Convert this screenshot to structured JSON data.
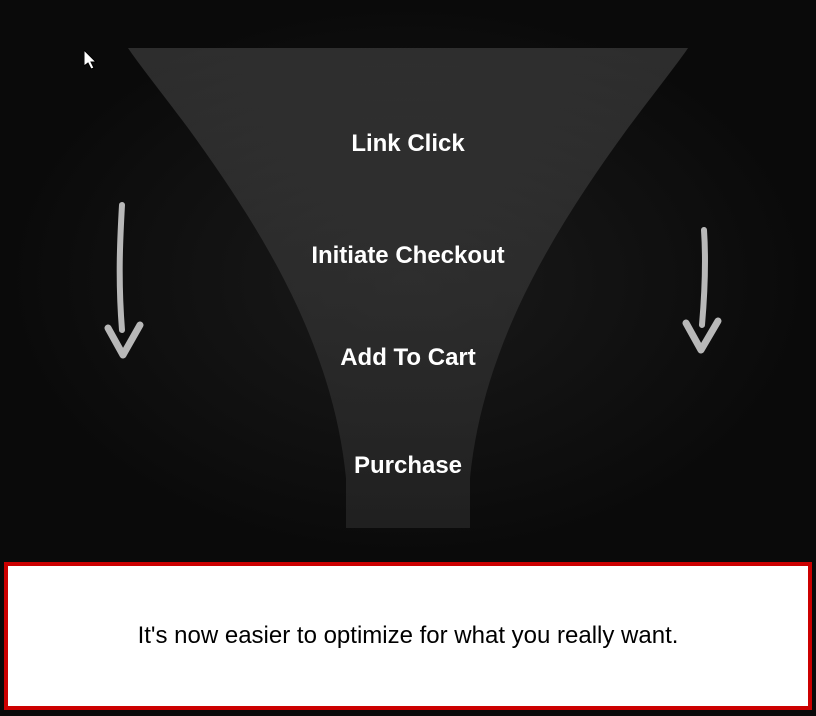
{
  "funnel": {
    "stages": [
      "Link Click",
      "Initiate Checkout",
      "Add To Cart",
      "Purchase"
    ]
  },
  "caption": "It's now easier to optimize for what you really want.",
  "colors": {
    "background": "#0a0a0a",
    "funnelFill": "#3a3a3a",
    "text": "#ffffff",
    "captionBorder": "#cc0000",
    "arrow": "#b0b0b0"
  }
}
